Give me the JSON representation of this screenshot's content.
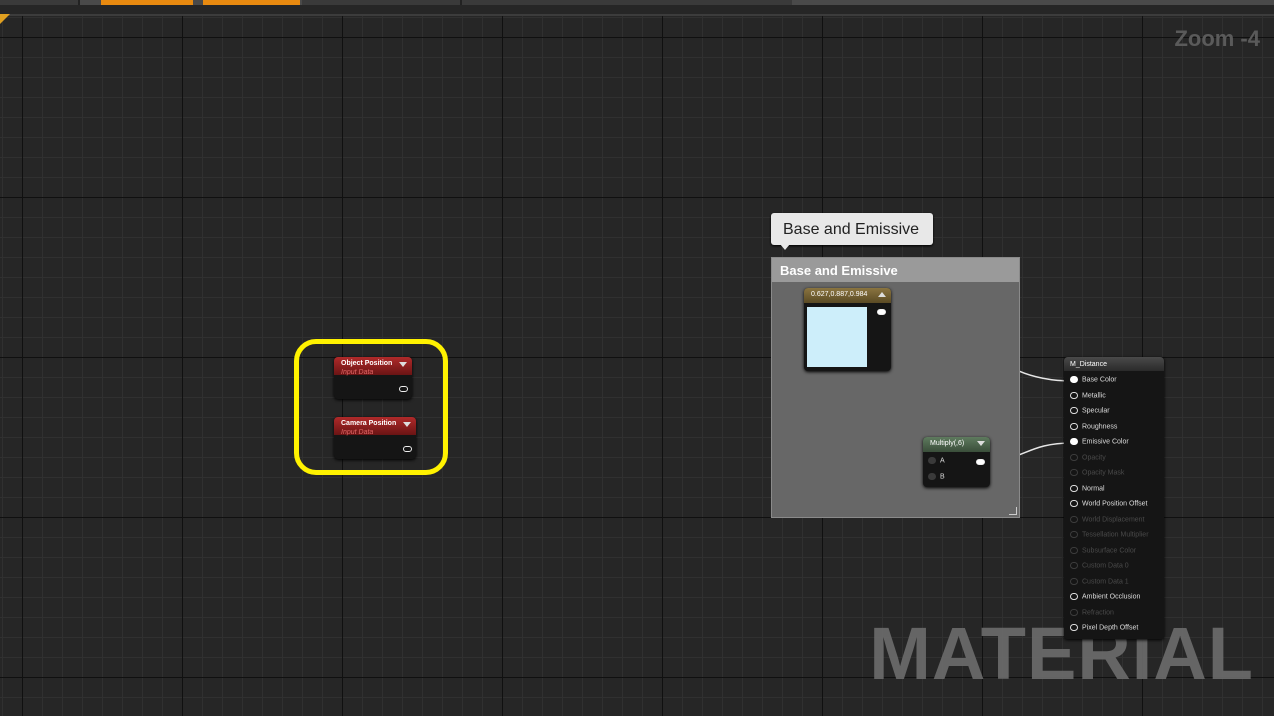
{
  "editor": {
    "zoom_label": "Zoom -4",
    "watermark": "MATERIAL",
    "accent_color": "#e88a10",
    "highlight_color": "#fff200"
  },
  "top_tabs": [
    {
      "state": "inactive"
    },
    {
      "state": "active"
    },
    {
      "state": "active"
    },
    {
      "state": "inactive"
    },
    {
      "state": "inactive"
    }
  ],
  "nodes": {
    "object_position": {
      "title": "Object Position",
      "subtitle": "Input Data"
    },
    "camera_position": {
      "title": "Camera Position",
      "subtitle": "Input Data"
    },
    "constant_color": {
      "title": "0.627,0.887,0.984",
      "swatch_color": "#cdeefa"
    },
    "multiply": {
      "title": "Multiply(,6)",
      "inputs": [
        "A",
        "B"
      ]
    },
    "result": {
      "title": "M_Distance",
      "pins": [
        {
          "label": "Base Color",
          "enabled": true,
          "connected": true
        },
        {
          "label": "Metallic",
          "enabled": true,
          "connected": false
        },
        {
          "label": "Specular",
          "enabled": true,
          "connected": false
        },
        {
          "label": "Roughness",
          "enabled": true,
          "connected": false
        },
        {
          "label": "Emissive Color",
          "enabled": true,
          "connected": true
        },
        {
          "label": "Opacity",
          "enabled": false,
          "connected": false
        },
        {
          "label": "Opacity Mask",
          "enabled": false,
          "connected": false
        },
        {
          "label": "Normal",
          "enabled": true,
          "connected": false
        },
        {
          "label": "World Position Offset",
          "enabled": true,
          "connected": false
        },
        {
          "label": "World Displacement",
          "enabled": false,
          "connected": false
        },
        {
          "label": "Tessellation Multiplier",
          "enabled": false,
          "connected": false
        },
        {
          "label": "Subsurface Color",
          "enabled": false,
          "connected": false
        },
        {
          "label": "Custom Data 0",
          "enabled": false,
          "connected": false
        },
        {
          "label": "Custom Data 1",
          "enabled": false,
          "connected": false
        },
        {
          "label": "Ambient Occlusion",
          "enabled": true,
          "connected": false
        },
        {
          "label": "Refraction",
          "enabled": false,
          "connected": false
        },
        {
          "label": "Pixel Depth Offset",
          "enabled": true,
          "connected": false
        }
      ]
    }
  },
  "comment": {
    "title": "Base and Emissive",
    "tooltip": "Base and Emissive"
  }
}
